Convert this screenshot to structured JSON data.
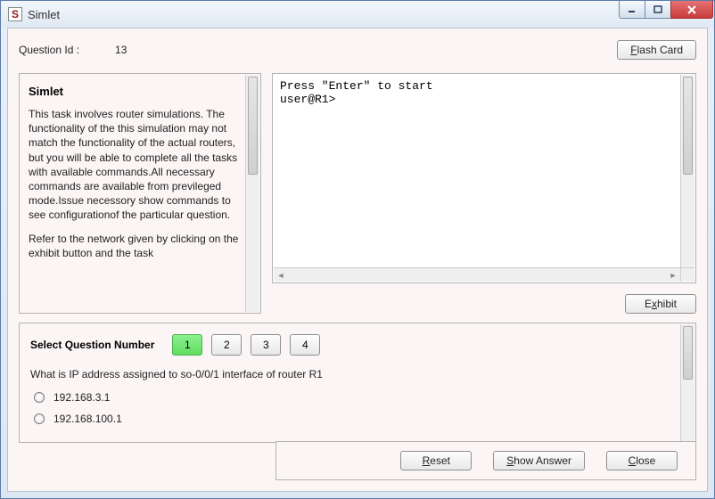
{
  "window": {
    "title": "Simlet",
    "icon_letter": "S"
  },
  "header": {
    "question_id_label": "Question Id :",
    "question_id_value": "13",
    "flash_card_label_pre": "F",
    "flash_card_label_rest": "lash Card"
  },
  "simlet_panel": {
    "title": "Simlet",
    "paragraph1": "This task involves router simulations. The functionality of the this simulation may not match the functionality of the actual routers, but you will be able to complete all the tasks with available commands.All necessary commands are available from previleged mode.Issue necessory show commands to see configurationof the particular question.",
    "paragraph2": "Refer to the network given by clicking on the exhibit button and the task"
  },
  "terminal": {
    "text": "Press \"Enter\" to start\nuser@R1>"
  },
  "exhibit": {
    "label_pre": "E",
    "label_u": "x",
    "label_rest": "hibit"
  },
  "question_area": {
    "select_label": "Select Question Number",
    "numbers": [
      "1",
      "2",
      "3",
      "4"
    ],
    "active_index": 0,
    "question_text": "What is IP address assigned to so-0/0/1 interface of router R1",
    "options": [
      "192.168.3.1",
      "192.168.100.1"
    ]
  },
  "footer": {
    "reset_pre": "R",
    "reset_rest": "eset",
    "show_pre": "S",
    "show_rest": "how Answer",
    "close_pre": "C",
    "close_rest": "lose"
  }
}
